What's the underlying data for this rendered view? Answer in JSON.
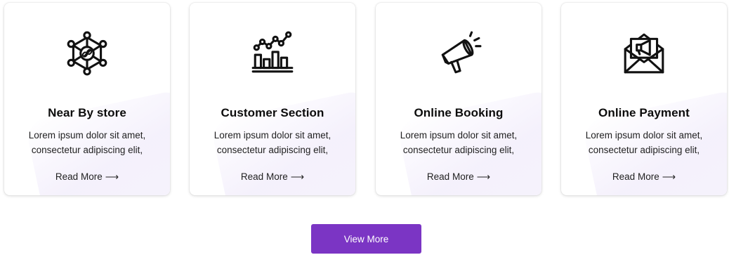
{
  "cards": [
    {
      "icon": "network-link-icon",
      "title": "Near By store",
      "description_line1": "Lorem ipsum dolor sit amet,",
      "description_line2": "consectetur adipiscing elit,",
      "link_label": "Read More",
      "link_arrow": "⟶"
    },
    {
      "icon": "bar-chart-trend-icon",
      "title": "Customer Section",
      "description_line1": "Lorem ipsum dolor sit amet,",
      "description_line2": "consectetur adipiscing elit,",
      "link_label": "Read More",
      "link_arrow": "⟶"
    },
    {
      "icon": "megaphone-icon",
      "title": "Online Booking",
      "description_line1": "Lorem ipsum dolor sit amet,",
      "description_line2": "consectetur adipiscing elit,",
      "link_label": "Read More",
      "link_arrow": "⟶"
    },
    {
      "icon": "envelope-megaphone-icon",
      "title": "Online Payment",
      "description_line1": "Lorem ipsum dolor sit amet,",
      "description_line2": "consectetur adipiscing elit,",
      "link_label": "Read More",
      "link_arrow": "⟶"
    }
  ],
  "view_more_label": "View More",
  "colors": {
    "button_bg": "#7b35c4",
    "button_text": "#ffffff",
    "title_text": "#0c0c0c",
    "body_text": "#222222"
  }
}
